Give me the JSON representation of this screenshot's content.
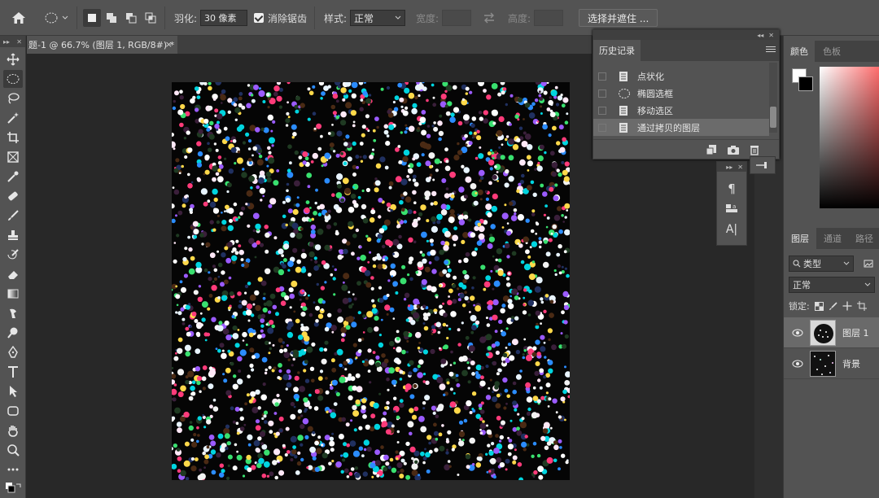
{
  "options_bar": {
    "feather_label": "羽化:",
    "feather_value": "30 像素",
    "antialias_label": "消除锯齿",
    "style_label": "样式:",
    "style_value": "正常",
    "width_label": "宽度:",
    "height_label": "高度:",
    "select_mask_button": "选择并遮住 ..."
  },
  "document": {
    "tab_title": "题-1 @ 66.7% (图层 1, RGB/8#) *",
    "close_glyph": "×"
  },
  "history_panel": {
    "tab_label": "历史记录",
    "items": [
      {
        "label": "点状化",
        "icon": "document-icon",
        "selected": false
      },
      {
        "label": "椭圆选框",
        "icon": "ellipse-marquee-icon",
        "selected": false
      },
      {
        "label": "移动选区",
        "icon": "document-icon",
        "selected": false
      },
      {
        "label": "通过拷贝的图层",
        "icon": "document-icon",
        "selected": true
      }
    ]
  },
  "color_panel": {
    "tabs": [
      "颜色",
      "色板"
    ],
    "foreground": "#ffffff",
    "background": "#000000"
  },
  "layers_panel": {
    "tabs": [
      "图层",
      "通道",
      "路径"
    ],
    "filter_value": "类型",
    "blend_mode": "正常",
    "lock_label": "锁定:",
    "layers": [
      {
        "name": "图层 1",
        "selected": true,
        "visible": true
      },
      {
        "name": "背景",
        "selected": false,
        "visible": true
      }
    ]
  },
  "mini_panel": {
    "character_glyph": "A|",
    "paragraph_glyph": "¶"
  },
  "colors": {
    "ui_dark": "#535353",
    "workspace": "#282828",
    "selected_row": "#6b6b6b"
  }
}
